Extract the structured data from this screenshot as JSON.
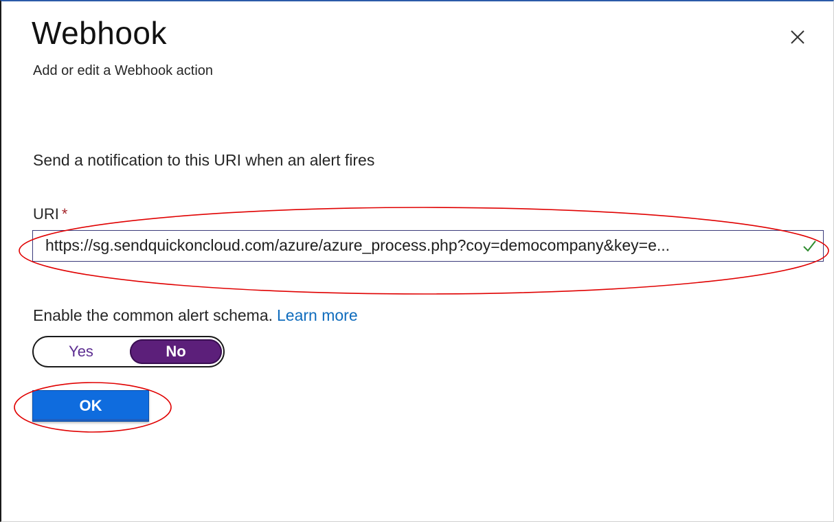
{
  "panel": {
    "title": "Webhook",
    "subtitle": "Add or edit a Webhook action",
    "close_icon": "close-icon"
  },
  "form": {
    "description": "Send a notification to this URI when an alert fires",
    "uri_label": "URI",
    "uri_required_mark": "*",
    "uri_value": "https://sg.sendquickoncloud.com/azure/azure_process.php?coy=democompany&key=e...",
    "uri_valid_icon": "checkmark-icon",
    "schema_label": "Enable the common alert schema.",
    "learn_more_label": "Learn more",
    "toggle": {
      "options": [
        "Yes",
        "No"
      ],
      "selected": "No"
    },
    "ok_label": "OK"
  },
  "colors": {
    "accent_purple": "#5c1f7a",
    "ok_blue": "#0f6cde",
    "link_blue": "#0f6cbd",
    "annotation_red": "#e00000",
    "required_red": "#a4262c",
    "valid_green": "#2e8b2e"
  }
}
